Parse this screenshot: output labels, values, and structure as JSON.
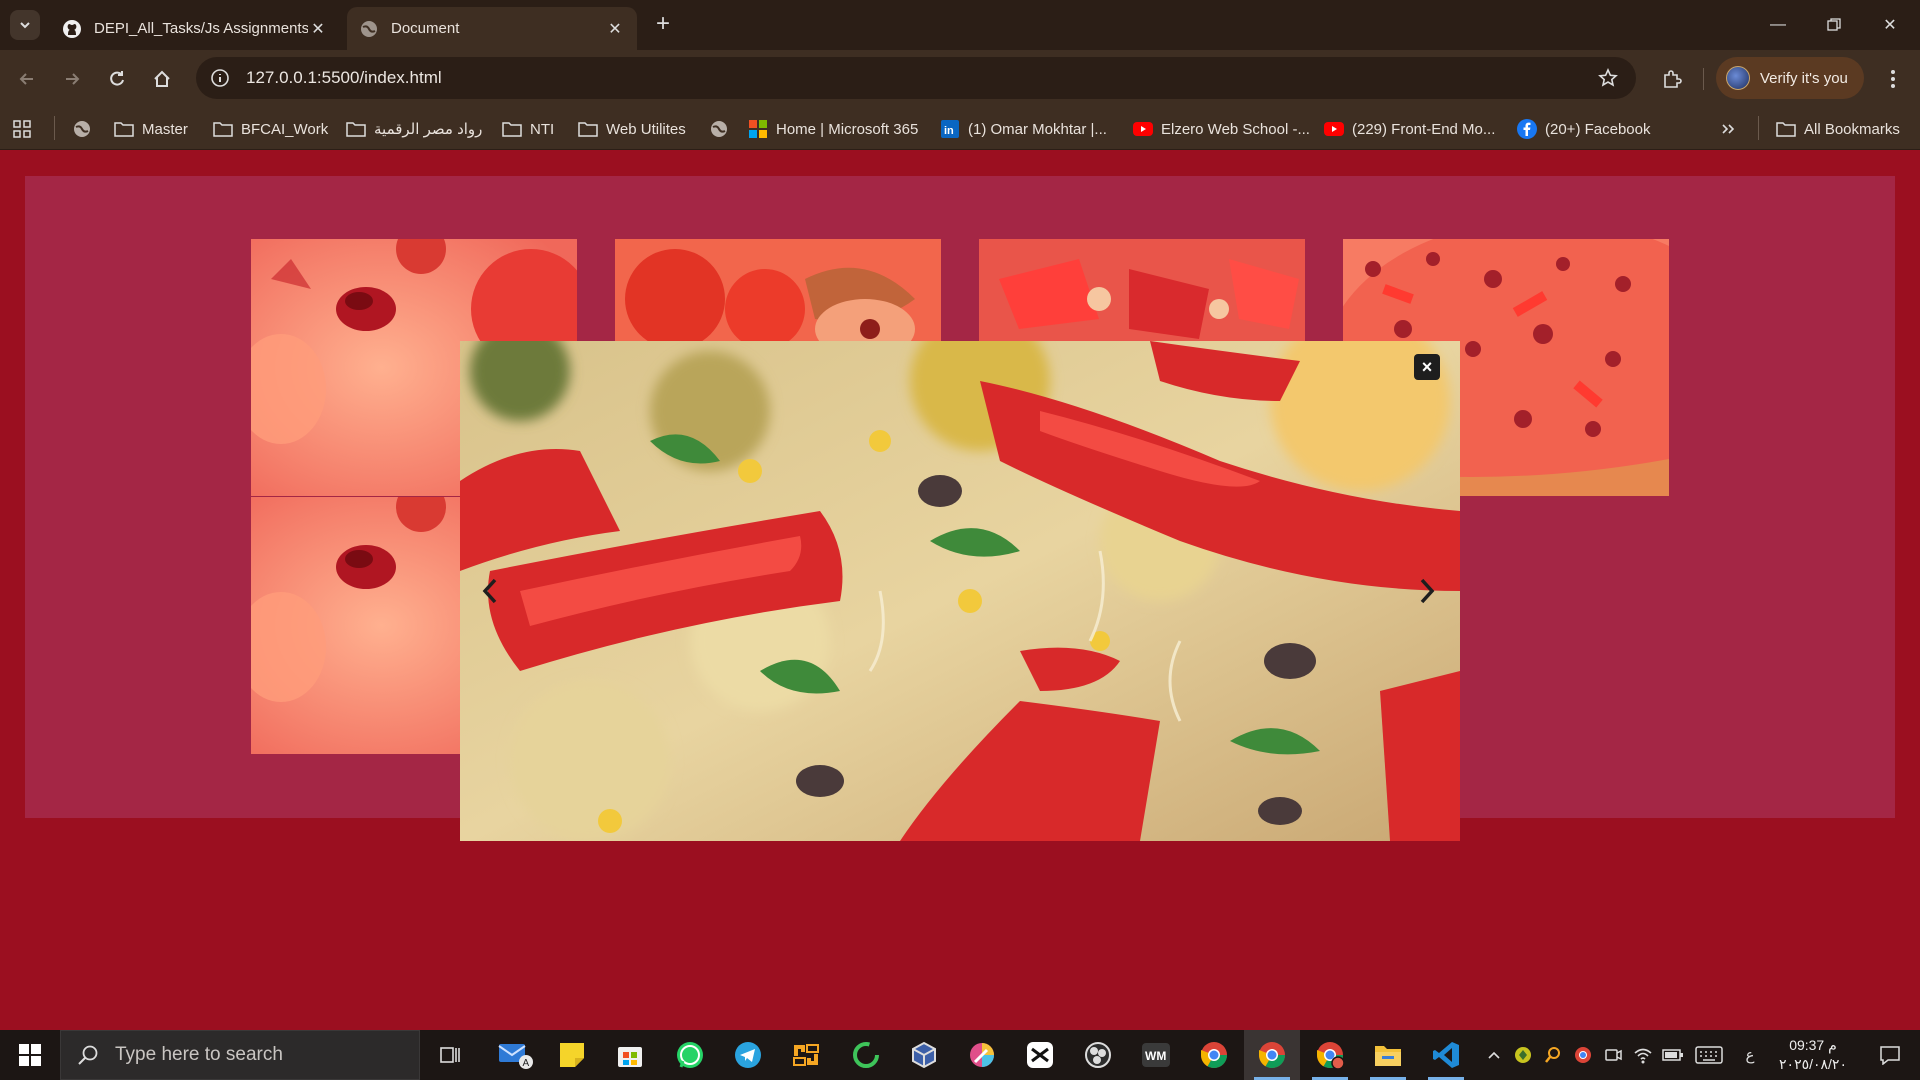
{
  "browser": {
    "tabs": [
      {
        "title": "DEPI_All_Tasks/Js Assignments/",
        "favicon": "github-icon",
        "active": false
      },
      {
        "title": "Document",
        "favicon": "globe-icon",
        "active": true
      }
    ],
    "address": "127.0.0.1:5500/index.html",
    "profile_label": "Verify it's you",
    "bookmarks": [
      {
        "label": "Master",
        "icon": "folder-icon"
      },
      {
        "label": "BFCAI_Work",
        "icon": "folder-icon"
      },
      {
        "label": "رواد مصر الرقمية",
        "icon": "folder-icon"
      },
      {
        "label": "NTI",
        "icon": "folder-icon"
      },
      {
        "label": "Web Utilites",
        "icon": "folder-icon"
      },
      {
        "label": "Home | Microsoft 365",
        "icon": "microsoft-icon"
      },
      {
        "label": "(1) Omar Mokhtar |...",
        "icon": "linkedin-icon"
      },
      {
        "label": "Elzero Web School -...",
        "icon": "youtube-icon"
      },
      {
        "label": "(229) Front-End Mo...",
        "icon": "youtube-icon"
      },
      {
        "label": "(20+) Facebook",
        "icon": "facebook-icon"
      }
    ],
    "all_bookmarks_label": "All Bookmarks"
  },
  "gallery": {
    "images": [
      "pizza-closeup-cheese",
      "pizza-tomatoes-basil",
      "pizza-peppers",
      "pizza-whole",
      "pizza-closeup-cheese"
    ],
    "lightbox": {
      "open": true,
      "image": "pizza-peppers-closeup",
      "close_symbol": "×"
    }
  },
  "taskbar": {
    "search_placeholder": "Type here to search",
    "apps": [
      "task-view-icon",
      "mail-icon",
      "sticky-notes-icon",
      "store-icon",
      "whatsapp-icon",
      "telegram-icon",
      "vmware-icon",
      "refresh-app-icon",
      "virtualbox-icon",
      "color-picker-icon",
      "capcut-icon",
      "obs-icon",
      "wm-icon",
      "chrome-icon",
      "chrome-active-icon",
      "chrome-profile-icon",
      "file-explorer-icon",
      "vscode-icon"
    ],
    "lang": "ع",
    "time": "09:37 م",
    "date": "٢٠٢٥/٠٨/٢٠"
  }
}
